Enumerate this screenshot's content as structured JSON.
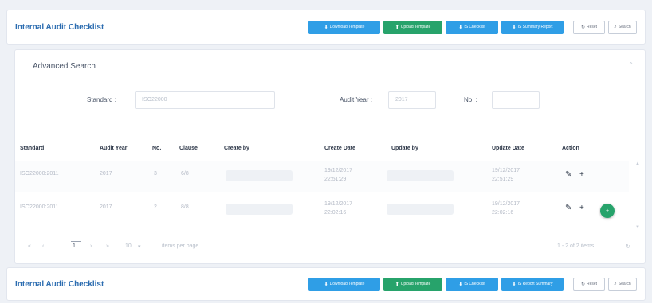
{
  "header": {
    "title": "Internal Audit Checklist",
    "buttons": [
      {
        "label": "Download Template",
        "icon": "download-icon"
      },
      {
        "label": "Upload Template",
        "icon": "upload-icon"
      },
      {
        "label": "IS Checklist",
        "icon": "download-icon"
      },
      {
        "label": "IS Summary Report",
        "icon": "download-icon"
      },
      {
        "label": "Reset",
        "icon": "reset-icon"
      },
      {
        "label": "Search",
        "icon": "search-icon"
      }
    ]
  },
  "advanced_search": {
    "title": "Advanced Search",
    "standard_label": "Standard :",
    "standard_value": "ISO22000",
    "audit_year_label": "Audit Year :",
    "audit_year_value": "2017",
    "no_label": "No. :"
  },
  "table": {
    "columns": [
      "Standard",
      "Audit Year",
      "No.",
      "Clause",
      "Create by",
      "Create Date",
      "Update by",
      "Update Date",
      "Action"
    ],
    "rows": [
      {
        "standard": "ISO22000:2011",
        "audit_year": "2017",
        "no": "3",
        "clause": "6/8",
        "create_date": "19/12/2017",
        "create_time": "22:51:29",
        "update_date": "19/12/2017",
        "update_time": "22:51:29"
      },
      {
        "standard": "ISO22000:2011",
        "audit_year": "2017",
        "no": "2",
        "clause": "8/8",
        "create_date": "19/12/2017",
        "create_time": "22:02:16",
        "update_date": "19/12/2017",
        "update_time": "22:02:16"
      }
    ]
  },
  "pager": {
    "current_page": "1",
    "page_size": "10",
    "items_per_page": "items per page",
    "count": "1 - 2 of 2 items"
  },
  "footer": {
    "title": "Internal Audit Checklist",
    "buttons": [
      {
        "label": "Download Template",
        "icon": "download-icon"
      },
      {
        "label": "Upload Template",
        "icon": "upload-icon"
      },
      {
        "label": "IS Checklist",
        "icon": "download-icon"
      },
      {
        "label": "IS Report Summary",
        "icon": "download-icon"
      },
      {
        "label": "Reset",
        "icon": "reset-icon"
      },
      {
        "label": "Search",
        "icon": "search-icon"
      }
    ]
  },
  "colors": {
    "primary": "#2f9ee6",
    "success": "#27a36b",
    "title": "#2b6cb0"
  }
}
